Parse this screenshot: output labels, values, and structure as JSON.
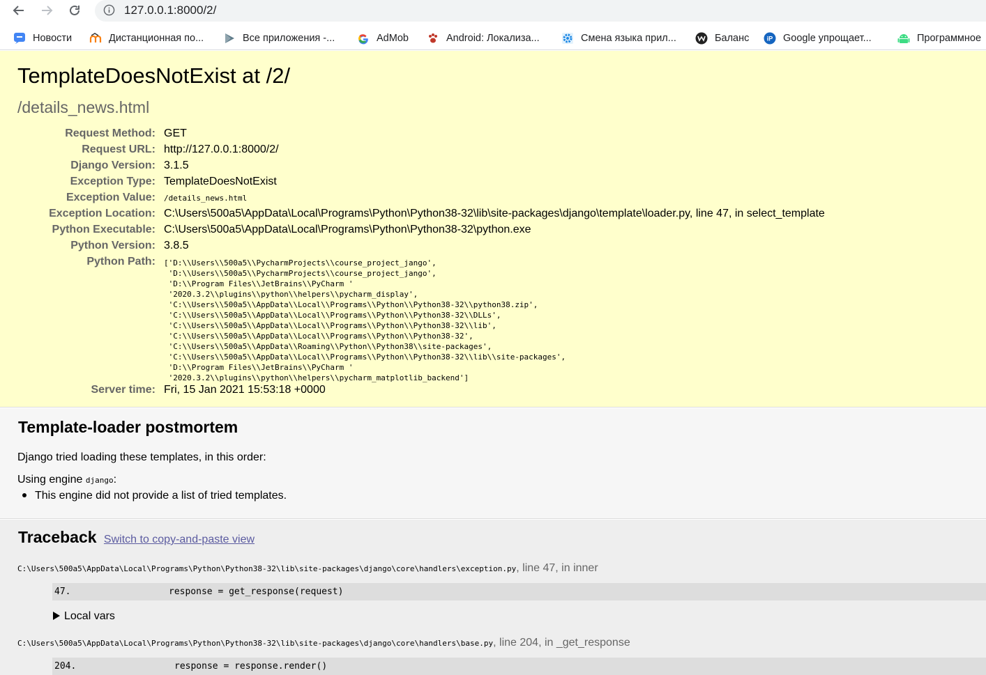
{
  "browser": {
    "url": "127.0.0.1:8000/2/",
    "bookmarks": [
      {
        "label": "Новости",
        "icon": "chat-icon"
      },
      {
        "label": "Дистанционная по...",
        "icon": "moodle-icon"
      },
      {
        "label": "Все приложения -...",
        "icon": "play-icon"
      },
      {
        "label": "AdMob",
        "icon": "google-icon"
      },
      {
        "label": "Android: Локализа...",
        "icon": "paw-icon"
      },
      {
        "label": "Смена языка прил...",
        "icon": "gear-icon"
      },
      {
        "label": "Баланс",
        "icon": "w-icon"
      },
      {
        "label": "Google упрощает...",
        "icon": "ip-icon"
      },
      {
        "label": "Программное",
        "icon": "android-icon"
      }
    ]
  },
  "summary": {
    "title": "TemplateDoesNotExist at /2/",
    "subtitle": "/details_news.html",
    "rows": [
      {
        "key": "Request Method:",
        "value": "GET"
      },
      {
        "key": "Request URL:",
        "value": "http://127.0.0.1:8000/2/"
      },
      {
        "key": "Django Version:",
        "value": "3.1.5"
      },
      {
        "key": "Exception Type:",
        "value": "TemplateDoesNotExist"
      },
      {
        "key": "Exception Value:",
        "value": "/details_news.html"
      },
      {
        "key": "Exception Location:",
        "value": "C:\\Users\\500a5\\AppData\\Local\\Programs\\Python\\Python38-32\\lib\\site-packages\\django\\template\\loader.py, line 47, in select_template"
      },
      {
        "key": "Python Executable:",
        "value": "C:\\Users\\500a5\\AppData\\Local\\Programs\\Python\\Python38-32\\python.exe"
      },
      {
        "key": "Python Version:",
        "value": "3.8.5"
      },
      {
        "key": "Python Path:",
        "value": "['D:\\\\Users\\\\500a5\\\\PycharmProjects\\\\course_project_jango',\n 'D:\\\\Users\\\\500a5\\\\PycharmProjects\\\\course_project_jango',\n 'D:\\\\Program Files\\\\JetBrains\\\\PyCharm '\n '2020.3.2\\\\plugins\\\\python\\\\helpers\\\\pycharm_display',\n 'C:\\\\Users\\\\500a5\\\\AppData\\\\Local\\\\Programs\\\\Python\\\\Python38-32\\\\python38.zip',\n 'C:\\\\Users\\\\500a5\\\\AppData\\\\Local\\\\Programs\\\\Python\\\\Python38-32\\\\DLLs',\n 'C:\\\\Users\\\\500a5\\\\AppData\\\\Local\\\\Programs\\\\Python\\\\Python38-32\\\\lib',\n 'C:\\\\Users\\\\500a5\\\\AppData\\\\Local\\\\Programs\\\\Python\\\\Python38-32',\n 'C:\\\\Users\\\\500a5\\\\AppData\\\\Roaming\\\\Python\\\\Python38\\\\site-packages',\n 'C:\\\\Users\\\\500a5\\\\AppData\\\\Local\\\\Programs\\\\Python\\\\Python38-32\\\\lib\\\\site-packages',\n 'D:\\\\Program Files\\\\JetBrains\\\\PyCharm '\n '2020.3.2\\\\plugins\\\\python\\\\helpers\\\\pycharm_matplotlib_backend']"
      },
      {
        "key": "Server time:",
        "value": "Fri, 15 Jan 2021 15:53:18 +0000"
      }
    ]
  },
  "postmortem": {
    "title": "Template-loader postmortem",
    "intro": "Django tried loading these templates, in this order:",
    "engine_prefix": "Using engine ",
    "engine_name": "django",
    "engine_suffix": ":",
    "item": "This engine did not provide a list of tried templates."
  },
  "traceback": {
    "title": "Traceback",
    "switch_link": "Switch to copy-and-paste view",
    "local_vars_label": "Local vars",
    "frames": [
      {
        "file": "C:\\Users\\500a5\\AppData\\Local\\Programs\\Python\\Python38-32\\lib\\site-packages\\django\\core\\handlers\\exception.py",
        "location": ", line 47, in inner",
        "line_no": "47.",
        "code": "response = get_response(request)"
      },
      {
        "file": "C:\\Users\\500a5\\AppData\\Local\\Programs\\Python\\Python38-32\\lib\\site-packages\\django\\core\\handlers\\base.py",
        "location": ", line 204, in _get_response",
        "line_no": "204.",
        "code": "response = response.render()"
      }
    ]
  },
  "colors": {
    "summary_bg": "#ffffcc",
    "postmortem_bg": "#f6f6f6",
    "traceback_bg": "#eeeeee",
    "context_line_bg": "#dddddd",
    "link": "#5b5ba0"
  }
}
